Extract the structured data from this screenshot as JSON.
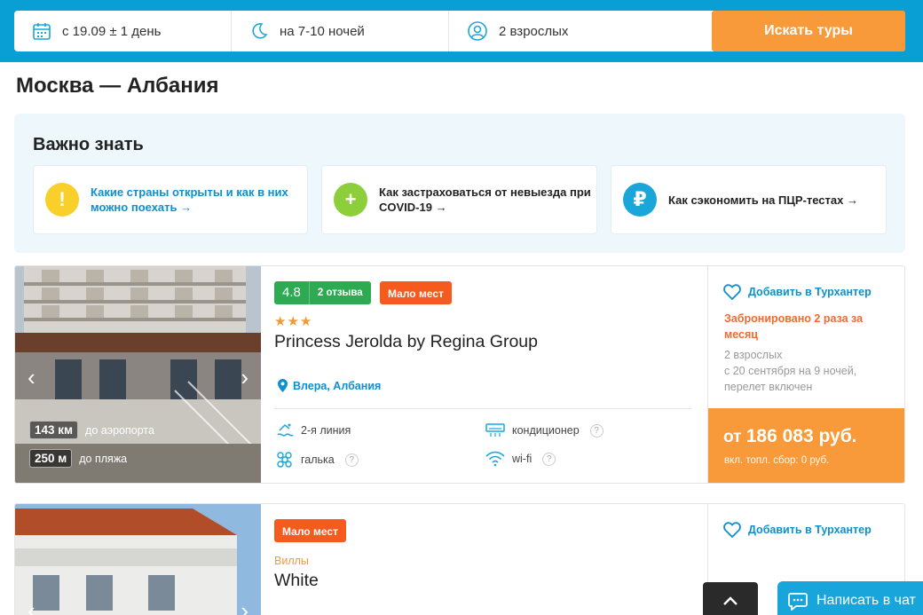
{
  "search": {
    "date": "с 19.09 ± 1 день",
    "nights": "на 7-10 ночей",
    "guests": "2 взрослых",
    "button": "Искать туры"
  },
  "route_title": "Москва — Албания",
  "important": {
    "title": "Важно знать",
    "cards": [
      {
        "text": "Какие страны открыты и как в них можно поехать →",
        "icon": "exclamation-icon",
        "color": "#f8cf2b"
      },
      {
        "text": "Как застраховаться от невыезда при COVID-19 →",
        "icon": "plus-icon",
        "color": "#8ccf3a"
      },
      {
        "text": "Как сэкономить на ПЦР-тестах →",
        "icon": "ruble-icon",
        "color": "#1aa6d8"
      }
    ]
  },
  "hotels": [
    {
      "score": "4.8",
      "reviews": "2 отзыва",
      "badge": "Мало мест",
      "stars": "★★★",
      "name": "Princess Jerolda by Regina Group",
      "location": "Влера, Албания",
      "airport_km": "143 км",
      "airport_label": "до аэропорта",
      "beach_m": "250 м",
      "beach_label": "до пляжа",
      "amenities": {
        "line": "2-я линия",
        "ac": "кондиционер",
        "beach": "галька",
        "wifi": "wi-fi",
        "help": "?"
      },
      "favorite": "Добавить в Турхантер",
      "booked": "Забронировано 2 раза за месяц",
      "details_1": "2 взрослых",
      "details_2": "с 20 сентября на 9 ночей,",
      "details_3": "перелет включен",
      "price_prefix": "от",
      "price": "186 083 руб.",
      "price_note": "вкл. топл. сбор: 0 руб."
    },
    {
      "badge": "Мало мест",
      "category": "Виллы",
      "name": "White",
      "favorite": "Добавить в Турхантер"
    }
  ],
  "floating": {
    "chat": "Написать в чат"
  },
  "colors": {
    "brand_blue": "#0a9fd4",
    "accent_orange": "#f8993a",
    "badge_red": "#f55a1e",
    "rating_green": "#2eaa52"
  }
}
